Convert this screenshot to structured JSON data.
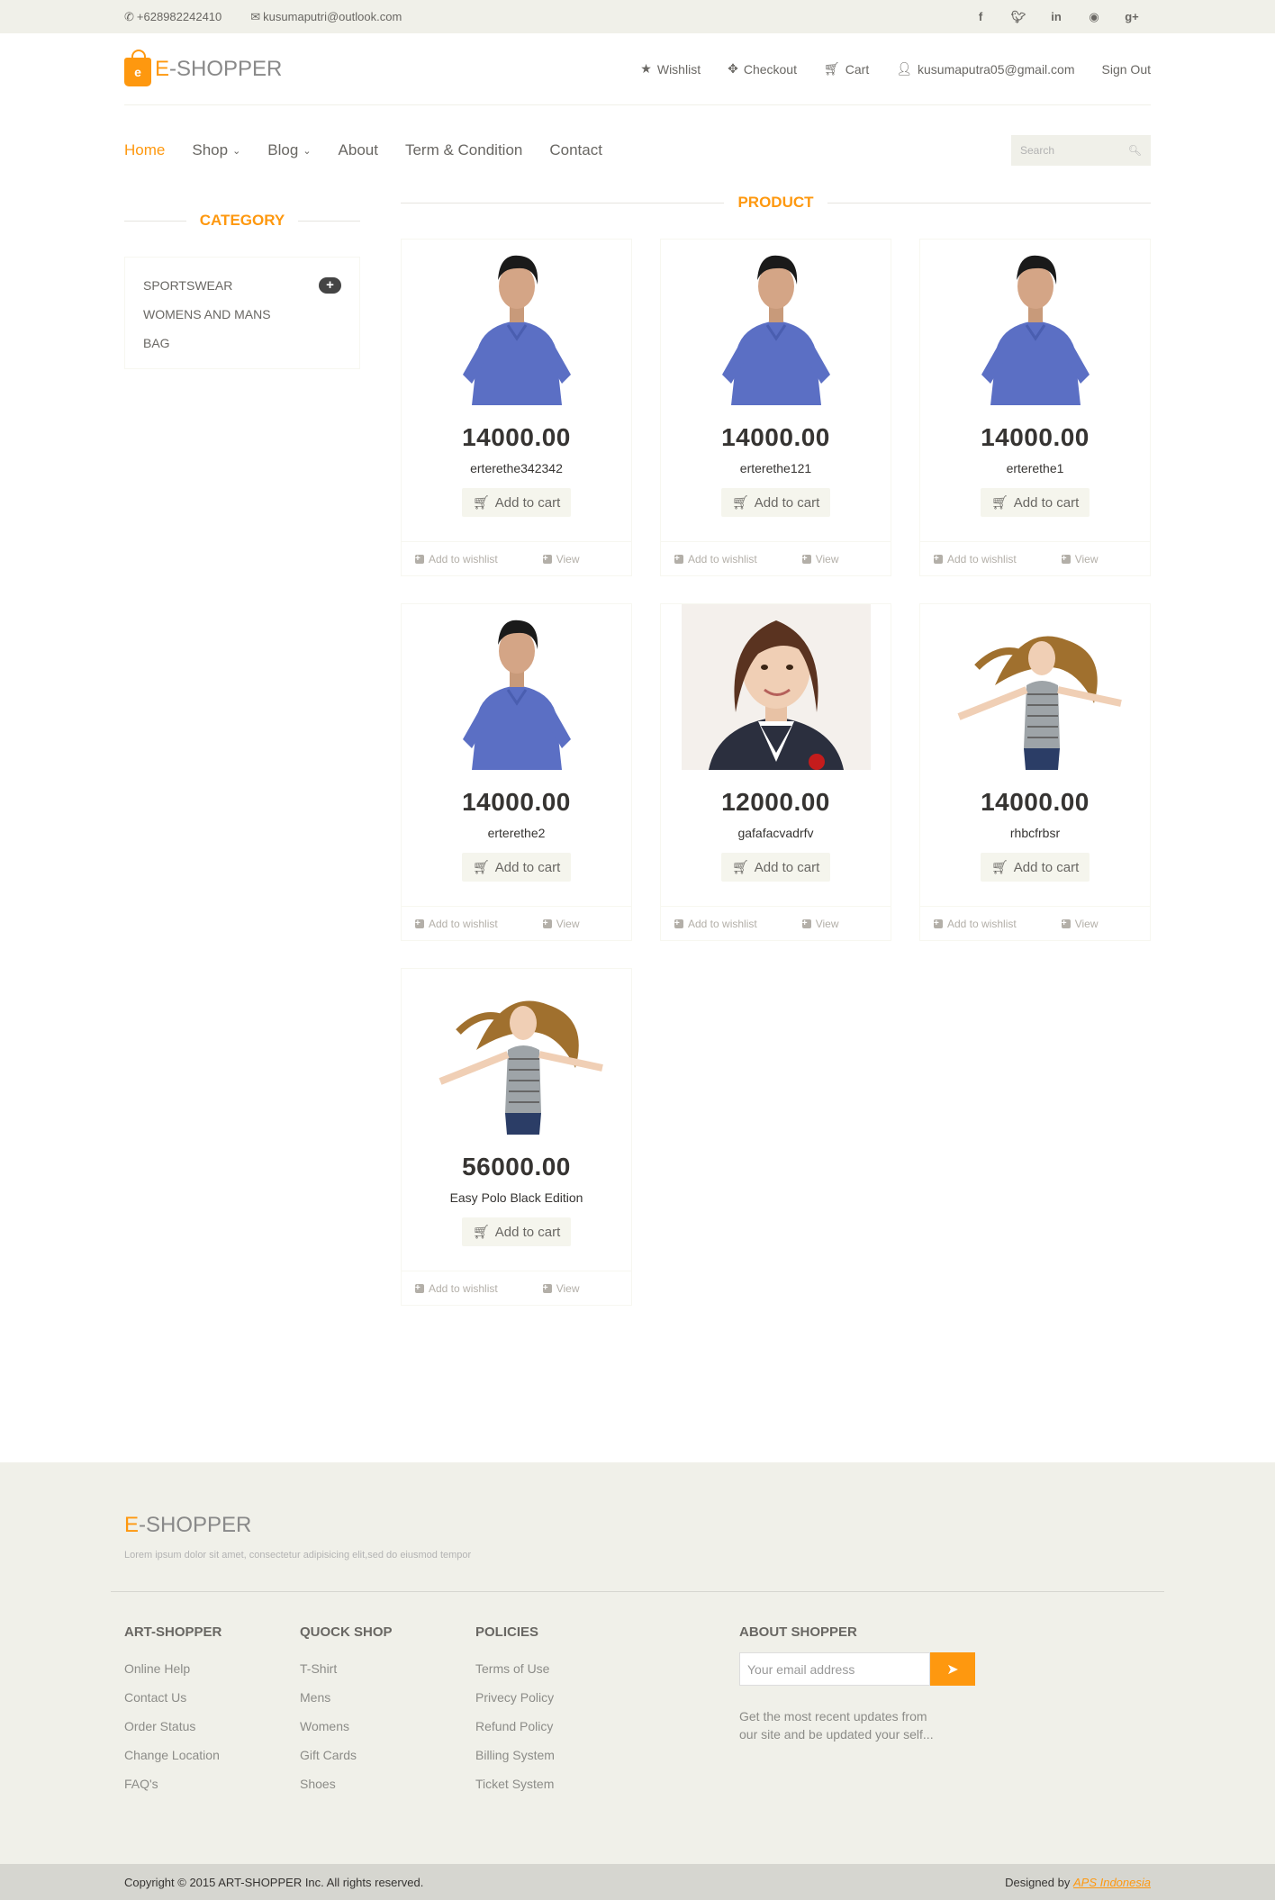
{
  "topbar": {
    "phone": "+628982242410",
    "email": "kusumaputri@outlook.com",
    "socials": [
      "facebook-icon",
      "twitter-icon",
      "linkedin-icon",
      "dribbble-icon",
      "google-plus-icon"
    ]
  },
  "header": {
    "logo_first": "E",
    "logo_rest": "-SHOPPER",
    "menu": {
      "wishlist": "Wishlist",
      "checkout": "Checkout",
      "cart": "Cart",
      "account": "kusumaputra05@gmail.com",
      "signout": "Sign Out"
    }
  },
  "nav": {
    "home": "Home",
    "shop": "Shop",
    "blog": "Blog",
    "about": "About",
    "terms": "Term & Condition",
    "contact": "Contact",
    "search_placeholder": "Search"
  },
  "sidebar": {
    "title": "CATEGORY",
    "categories": [
      "SPORTSWEAR",
      "WOMENS AND MANS",
      "BAG"
    ]
  },
  "products": {
    "title": "PRODUCT",
    "add_to_cart": "Add to cart",
    "add_to_wishlist": "Add to wishlist",
    "view": "View",
    "items": [
      {
        "price": "14000.00",
        "name": "erterethe342342"
      },
      {
        "price": "14000.00",
        "name": "erterethe121"
      },
      {
        "price": "14000.00",
        "name": "erterethe1"
      },
      {
        "price": "14000.00",
        "name": "erterethe2"
      },
      {
        "price": "12000.00",
        "name": "gafafacvadrfv"
      },
      {
        "price": "14000.00",
        "name": "rhbcfrbsr"
      },
      {
        "price": "56000.00",
        "name": "Easy Polo Black Edition"
      }
    ]
  },
  "footer": {
    "logo_first": "E",
    "logo_rest": "-SHOPPER",
    "description": "Lorem ipsum dolor sit amet, consectetur adipisicing elit,sed do eiusmod tempor",
    "col1": {
      "title": "ART-SHOPPER",
      "links": [
        "Online Help",
        "Contact Us",
        "Order Status",
        "Change Location",
        "FAQ's"
      ]
    },
    "col2": {
      "title": "QUOCK SHOP",
      "links": [
        "T-Shirt",
        "Mens",
        "Womens",
        "Gift Cards",
        "Shoes"
      ]
    },
    "col3": {
      "title": "POLICIES",
      "links": [
        "Terms of Use",
        "Privecy Policy",
        "Refund Policy",
        "Billing System",
        "Ticket System"
      ]
    },
    "about": {
      "title": "ABOUT SHOPPER",
      "email_placeholder": "Your email address",
      "text": "Get the most recent updates from our site and be updated your self..."
    },
    "copyright": "Copyright © 2015 ART-SHOPPER Inc. All rights reserved.",
    "designed_by": "Designed by",
    "designer": "APS Indonesia"
  },
  "colors": {
    "accent": "#fe980f",
    "topbar_bg": "#f0f0e9",
    "footer_bottom_bg": "#d6d6d0"
  }
}
